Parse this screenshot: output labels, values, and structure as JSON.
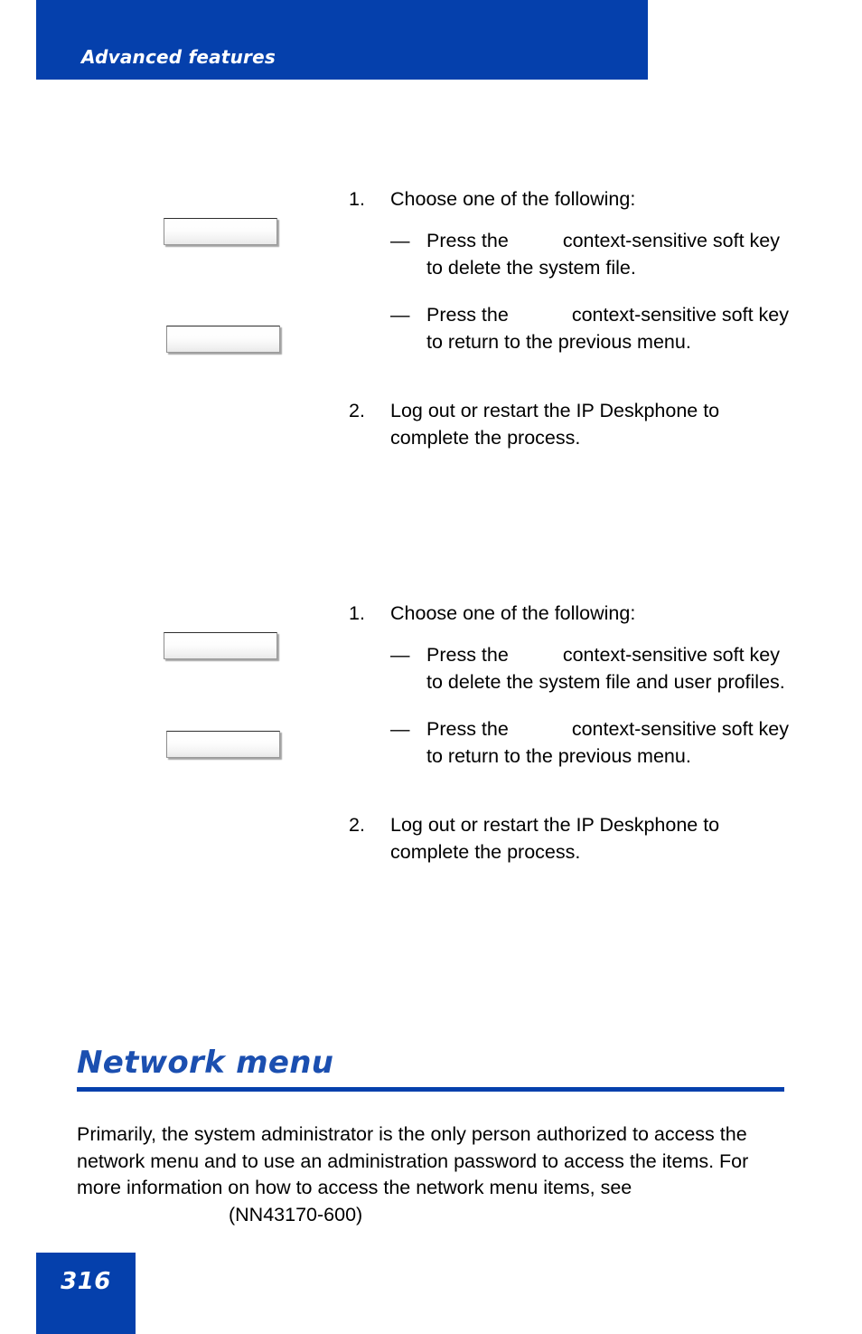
{
  "header": {
    "running_title": "Advanced features"
  },
  "procedures": [
    {
      "id": "delete-system-file",
      "soft_keys": [
        {
          "name": "soft-key-confirm",
          "label": ""
        },
        {
          "name": "soft-key-back",
          "label": ""
        }
      ],
      "steps": [
        {
          "number": "1.",
          "text": "Choose one of the following:",
          "sub_items": [
            {
              "dash": "—",
              "before_gap": "Press the",
              "after_gap": "context-sensitive soft key to delete the system file."
            },
            {
              "dash": "—",
              "before_gap": "Press the",
              "after_gap": "context-sensitive soft key to return to the previous menu."
            }
          ]
        },
        {
          "number": "2.",
          "text": "Log out or restart the IP Deskphone to complete the process.",
          "sub_items": []
        }
      ]
    },
    {
      "id": "delete-system-file-and-user-profiles",
      "soft_keys": [
        {
          "name": "soft-key-confirm",
          "label": ""
        },
        {
          "name": "soft-key-back",
          "label": ""
        }
      ],
      "steps": [
        {
          "number": "1.",
          "text": "Choose one of the following:",
          "sub_items": [
            {
              "dash": "—",
              "before_gap": "Press the",
              "after_gap": "context-sensitive soft key to delete the system file and user profiles."
            },
            {
              "dash": "—",
              "before_gap": "Press the",
              "after_gap": "context-sensitive soft key to return to the previous menu."
            }
          ]
        },
        {
          "number": "2.",
          "text": "Log out or restart the IP Deskphone to complete the process.",
          "sub_items": []
        }
      ]
    }
  ],
  "section": {
    "heading": "Network menu",
    "paragraph_before_ref": "Primarily, the system administrator is the only person authorized to access the network menu and to use an administration password to access the items. For more information on how to access the network menu items, see",
    "document_reference": "(NN43170-600)"
  },
  "footer": {
    "page_number": "316"
  },
  "colors": {
    "brand_blue": "#0540AC",
    "heading_blue": "#1B4FB0",
    "page_background": "#FFFFFF",
    "text": "#000000"
  }
}
